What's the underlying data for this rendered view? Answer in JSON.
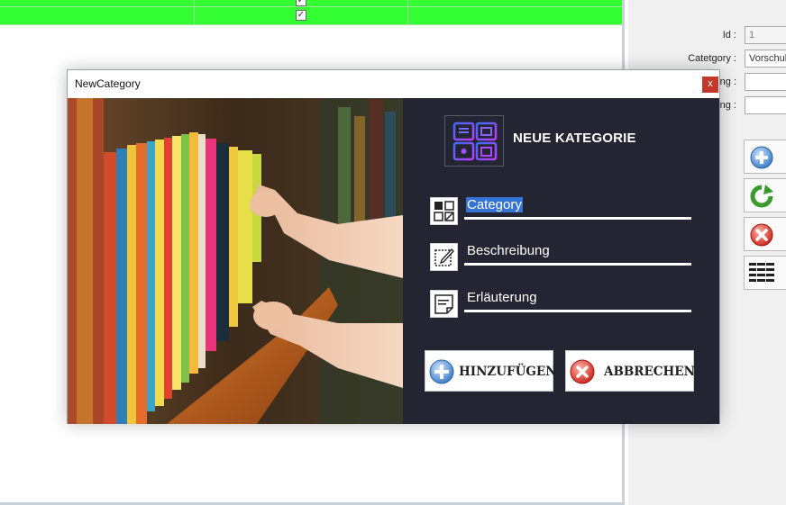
{
  "background_grid": {
    "row_color": "#33ff33",
    "checkbox_mark": "✓"
  },
  "side_panel": {
    "id_label": "Id :",
    "id_value": "1",
    "category_label": "Catetgory :",
    "category_value": "Vorschule",
    "field3_label": "ung :",
    "field4_label": "ng :",
    "buttons": [
      {
        "icon": "add-icon"
      },
      {
        "icon": "refresh-icon"
      },
      {
        "icon": "delete-icon"
      },
      {
        "icon": "list-icon"
      }
    ]
  },
  "dialog": {
    "title": "NewCategory",
    "close_label": "x",
    "heading": "NEUE KATEGORIE",
    "fields": [
      {
        "icon": "category-icon",
        "value": "Category"
      },
      {
        "icon": "edit-icon",
        "value": "Beschreibung"
      },
      {
        "icon": "note-icon",
        "value": "Erläuterung"
      }
    ],
    "add_button": "HINZUFÜGEN",
    "cancel_button": "ABBRECHEN",
    "colors": {
      "panel": "#242532",
      "selection": "#3574d4",
      "logo_gradient": [
        "#3b6cff",
        "#c03bff"
      ]
    }
  }
}
